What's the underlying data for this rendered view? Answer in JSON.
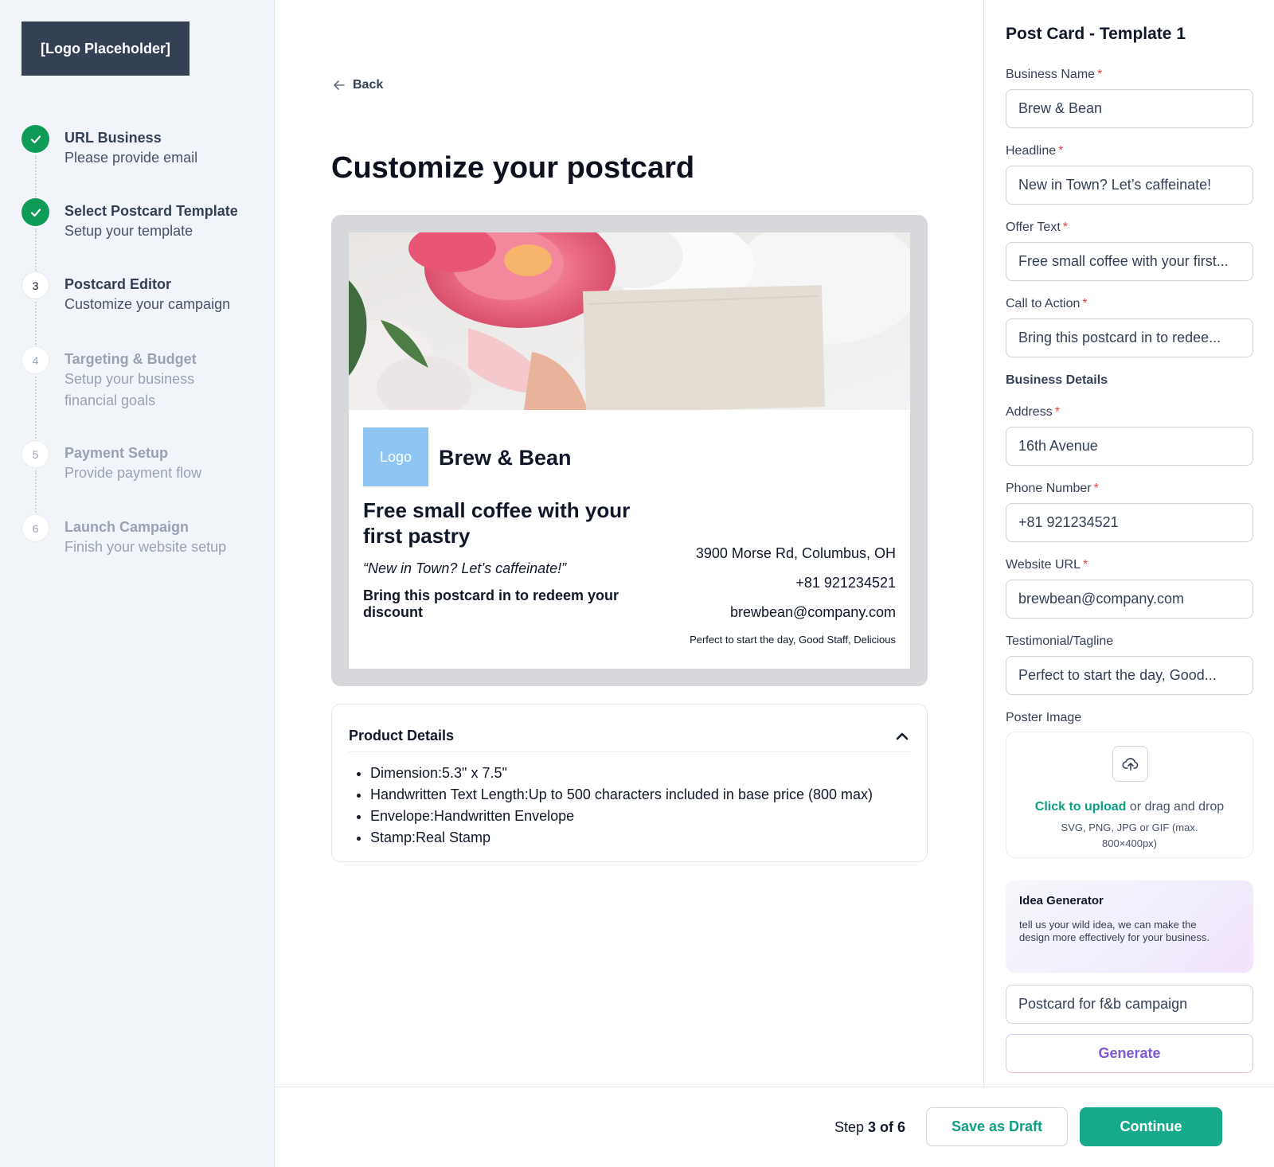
{
  "sidebar": {
    "logo_label": "[Logo Placeholder]",
    "steps": [
      {
        "number": "1",
        "title": "URL Business",
        "subtitle": "Please provide email",
        "status": "done"
      },
      {
        "number": "2",
        "title": "Select Postcard Template",
        "subtitle": "Setup your template",
        "status": "done"
      },
      {
        "number": "3",
        "title": "Postcard Editor",
        "subtitle": "Customize your campaign",
        "status": "current"
      },
      {
        "number": "4",
        "title": "Targeting & Budget",
        "subtitle": "Setup your business financial goals",
        "status": "todo"
      },
      {
        "number": "5",
        "title": "Payment Setup",
        "subtitle": "Provide payment flow",
        "status": "todo"
      },
      {
        "number": "6",
        "title": "Launch Campaign",
        "subtitle": "Finish your website setup",
        "status": "todo"
      }
    ]
  },
  "main": {
    "back_label": "Back",
    "page_title": "Customize your postcard",
    "postcard": {
      "logo_label": "Logo",
      "business_name": "Brew & Bean",
      "offer": "Free small coffee with your first pastry",
      "headline": "“New in Town? Let’s caffeinate!”",
      "cta": "Bring this postcard in to redeem your discount",
      "address": "3900 Morse Rd, Columbus, OH",
      "phone": "+81 921234521",
      "website": "brewbean@company.com",
      "tagline": "Perfect to start the day, Good Staff, Delicious"
    },
    "product_details": {
      "title": "Product Details",
      "items": [
        "Dimension:5.3\" x 7.5\"",
        "Handwritten Text Length:Up to 500 characters included in base price (800 max)",
        "Envelope:Handwritten Envelope",
        "Stamp:Real Stamp"
      ]
    }
  },
  "panel": {
    "title": "Post Card - Template 1",
    "fields": {
      "business_name": {
        "label": "Business Name",
        "value": "Brew & Bean"
      },
      "headline": {
        "label": "Headline",
        "value": "New in Town? Let’s caffeinate!"
      },
      "offer_text": {
        "label": "Offer Text",
        "value": "Free small coffee with your first..."
      },
      "cta": {
        "label": "Call to Action",
        "value": "Bring this postcard in to redee..."
      },
      "address": {
        "label": "Address",
        "value": "16th Avenue"
      },
      "phone": {
        "label": "Phone Number",
        "value": "+81 921234521"
      },
      "website": {
        "label": "Website URL",
        "value": "brewbean@company.com"
      },
      "tagline": {
        "label": "Testimonial/Tagline",
        "value": "Perfect to start the day, Good..."
      }
    },
    "required_marker": "*",
    "business_details_label": "Business Details",
    "poster_image": {
      "label": "Poster Image",
      "link_text": "Click to upload",
      "rest_text": " or drag and drop",
      "hint": "SVG, PNG, JPG or GIF (max. 800×400px)"
    },
    "idea_generator": {
      "title": "Idea Generator",
      "description": "tell us your wild idea, we can make the design more effectively for your business.",
      "input_value": "Postcard for f&b campaign",
      "button_label": "Generate"
    }
  },
  "footer": {
    "step_prefix": "Step ",
    "step_value": "3 of 6",
    "draft_label": "Save as Draft",
    "continue_label": "Continue"
  },
  "colors": {
    "accent": "#17a98c",
    "done": "#0e9b57",
    "required": "#f04438",
    "generate": "#7f56d9"
  }
}
